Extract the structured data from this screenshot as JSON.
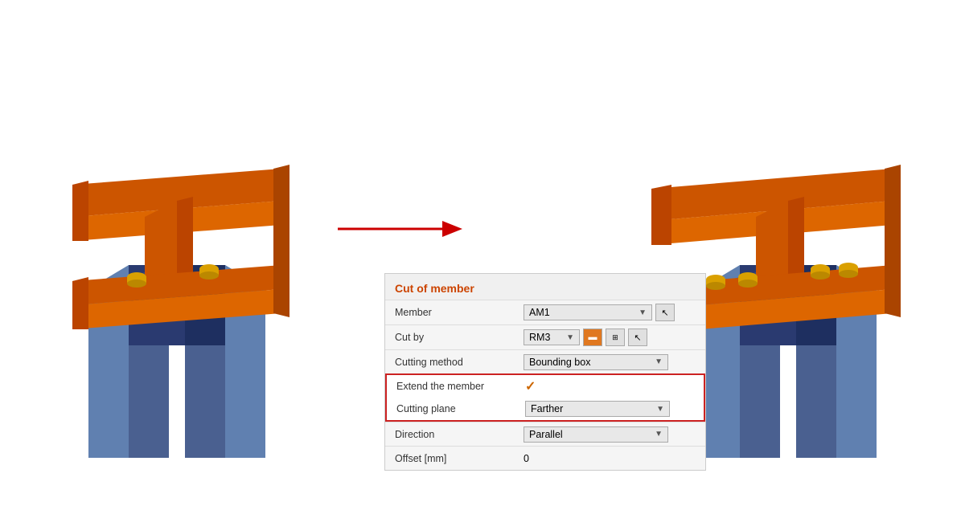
{
  "panel": {
    "title": "Cut of member",
    "rows": [
      {
        "label": "Member",
        "value": "AM1",
        "type": "select",
        "icons": [
          "cursor"
        ]
      },
      {
        "label": "Cut by",
        "value": "RM3",
        "type": "select-icons",
        "icons": [
          "orange-block",
          "grid-block",
          "cursor"
        ]
      },
      {
        "label": "Cutting method",
        "value": "Bounding box",
        "type": "select"
      },
      {
        "label": "Extend the member",
        "value": "",
        "type": "checkbox",
        "checked": true,
        "highlighted": true
      },
      {
        "label": "Cutting plane",
        "value": "Farther",
        "type": "select",
        "highlighted": true
      },
      {
        "label": "Direction",
        "value": "Parallel",
        "type": "select"
      },
      {
        "label": "Offset [mm]",
        "value": "0",
        "type": "text"
      }
    ]
  },
  "arrow": {
    "color": "#cc0000"
  }
}
